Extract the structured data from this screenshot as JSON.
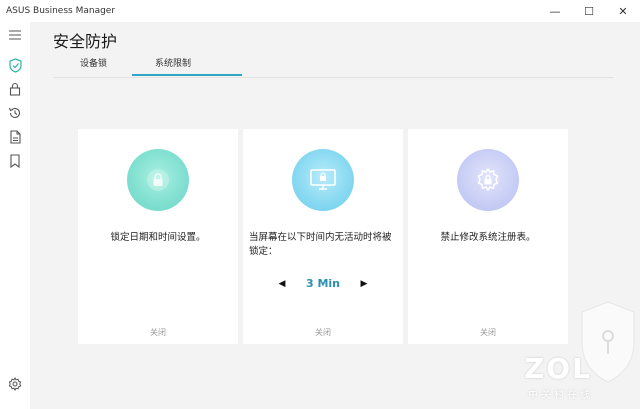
{
  "window": {
    "title": "ASUS Business Manager",
    "controls": {
      "minimize": "—",
      "maximize": "☐",
      "close": "✕"
    }
  },
  "sidebar": {
    "items": [
      {
        "icon": "hamburger-menu-icon"
      },
      {
        "icon": "shield-check-icon",
        "active": true
      },
      {
        "icon": "lock-icon"
      },
      {
        "icon": "history-icon"
      },
      {
        "icon": "document-icon"
      },
      {
        "icon": "bookmark-icon"
      },
      {
        "icon": "gear-icon"
      }
    ]
  },
  "page": {
    "title": "安全防护",
    "tabs": [
      {
        "label": "设备锁",
        "active": false
      },
      {
        "label": "系统限制",
        "active": true
      }
    ]
  },
  "cards": [
    {
      "icon": "lock-icon",
      "description": "锁定日期和时间设置。",
      "status": "关闭"
    },
    {
      "icon": "monitor-lock-icon",
      "description": "当屏幕在以下时间内无活动时将被锁定：",
      "timer": {
        "value": "3 Min",
        "prev": "◀",
        "next": "▶"
      },
      "status": "关闭"
    },
    {
      "icon": "gear-lock-icon",
      "description": "禁止修改系统注册表。",
      "status": "关闭"
    }
  ],
  "watermark": {
    "text": "ZOL",
    "subtext": "中关村在线"
  },
  "colors": {
    "accent": "#2fa6c5",
    "timer": "#2b8fb3",
    "active_icon": "#2fb3a1"
  }
}
